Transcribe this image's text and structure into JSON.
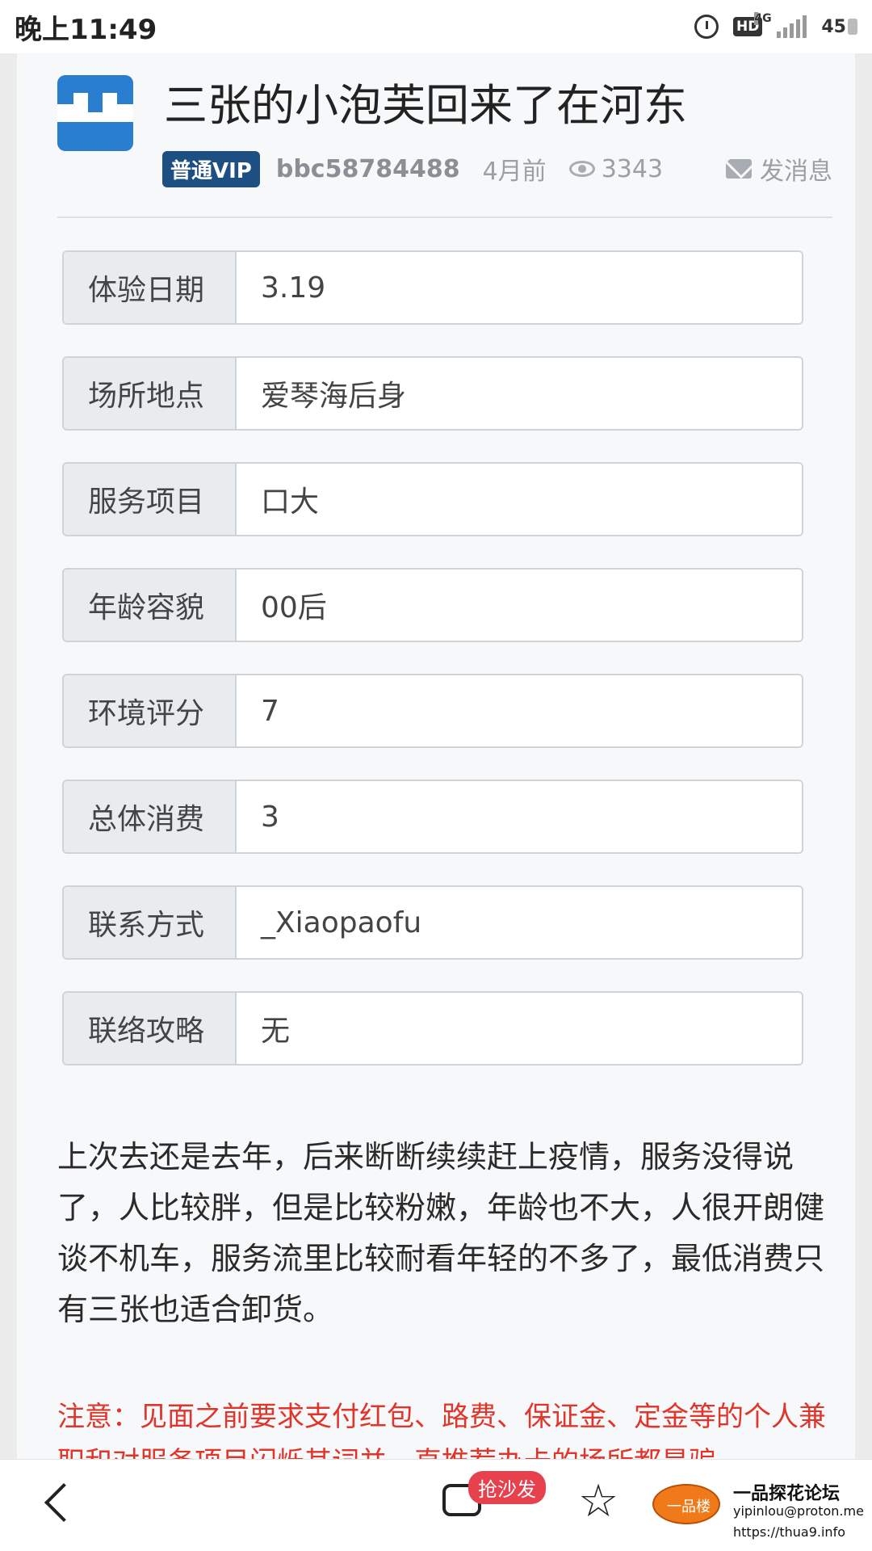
{
  "status_bar": {
    "time": "晚上11:49",
    "hd": "HD",
    "network": "4G",
    "battery": "45"
  },
  "post": {
    "title": "三张的小泡芙回来了在河东",
    "vip_label": "普通VIP",
    "username": "bbc58784488",
    "posted_ago": "4月前",
    "views": "3343",
    "message_label": "发消息"
  },
  "fields": [
    {
      "label": "体验日期",
      "value": "3.19"
    },
    {
      "label": "场所地点",
      "value": "爱琴海后身"
    },
    {
      "label": "服务项目",
      "value": "口大"
    },
    {
      "label": "年龄容貌",
      "value": "00后"
    },
    {
      "label": "环境评分",
      "value": "7"
    },
    {
      "label": "总体消费",
      "value": "3"
    },
    {
      "label": "联系方式",
      "value": "_Xiaopaofu"
    },
    {
      "label": "联络攻略",
      "value": "无"
    }
  ],
  "content": {
    "body": "上次去还是去年，后来断断续续赶上疫情，服务没得说了，人比较胖，但是比较粉嫩，年龄也不大，人很开朗健谈不机车，服务流里比较耐看年轻的不多了，最低消费只有三张也适合卸货。",
    "notice": "注意：见面之前要求支付红包、路费、保证金、定金等的个人兼职和对服务项目闪烁其词并一直推荐办卡的场所都是骗"
  },
  "bottom_bar": {
    "comment_badge": "抢沙发",
    "logo_text": "一品楼",
    "logo_title": "一品探花论坛",
    "logo_sub": "yipinlou@proton.me",
    "logo_url": "https://thua9.info"
  }
}
